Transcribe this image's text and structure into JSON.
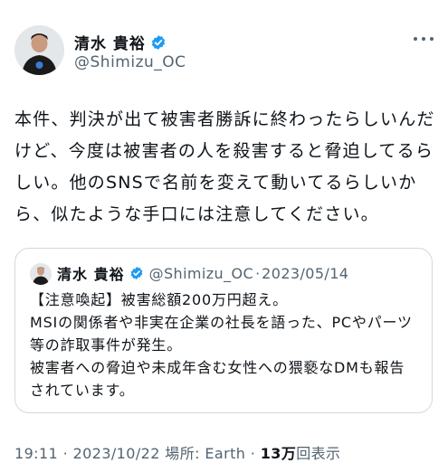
{
  "author": {
    "name": "清水 貴裕",
    "handle": "@Shimizu_OC",
    "verified_color": "#1d9bf0"
  },
  "more_icon": "more-horizontal-icon",
  "tweet": {
    "text": "本件、判決が出て被害者勝訴に終わったらしいんだけど、今度は被害者の人を殺害すると脅迫してるらしい。他のSNSで名前を変えて動いてるらしいから、似たような手口には注意してください。"
  },
  "quote": {
    "name": "清水 貴裕",
    "handle": "@Shimizu_OC",
    "separator": "·",
    "date": "2023/05/14",
    "text": "【注意喚起】被害総額200万円超え。\nMSIの関係者や非実在企業の社長を語った、PCやパーツ等の詐取事件が発生。\n被害者への脅迫や未成年含む女性への猥褻なDMも報告されています。"
  },
  "meta": {
    "time": "19:11",
    "date": "2023/10/22",
    "place_label": "場所:",
    "place": "Earth",
    "views_count": "13万",
    "views_label": "回表示"
  }
}
